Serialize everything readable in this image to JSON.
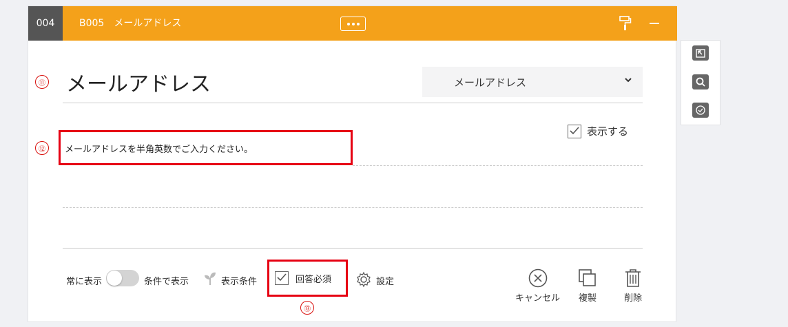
{
  "header": {
    "question_number": "004",
    "block_code": "B005",
    "block_title": "メールアドレス"
  },
  "markers": {
    "title_marker": "⑪",
    "description_marker": "⑫",
    "required_marker": "⑬"
  },
  "question": {
    "title": "メールアドレス",
    "type_select_value": "メールアドレス",
    "show_label": "表示する",
    "show_checked": true,
    "description": "メールアドレスを半角英数でご入力ください。"
  },
  "footer": {
    "always_show_label": "常に表示",
    "conditional_show_label": "条件で表示",
    "toggle_on": false,
    "display_condition_label": "表示条件",
    "required_label": "回答必須",
    "required_checked": true,
    "settings_label": "設定",
    "cancel_label": "キャンセル",
    "duplicate_label": "複製",
    "delete_label": "削除"
  },
  "colors": {
    "header": "#f4a11a",
    "number_bg": "#555555",
    "highlight": "#e60012",
    "marker": "#d9100d"
  },
  "icons": {
    "more": "more-dots-icon",
    "paint": "paint-roller-icon",
    "minimize": "minimize-icon",
    "chevron": "chevron-down-icon",
    "display_condition": "sprout-icon",
    "settings": "gear-icon",
    "cancel": "circle-x-icon",
    "duplicate": "copy-icon",
    "delete": "trash-icon",
    "side_1": "insert-icon",
    "side_2": "search-icon",
    "side_3": "check-circle-icon"
  }
}
